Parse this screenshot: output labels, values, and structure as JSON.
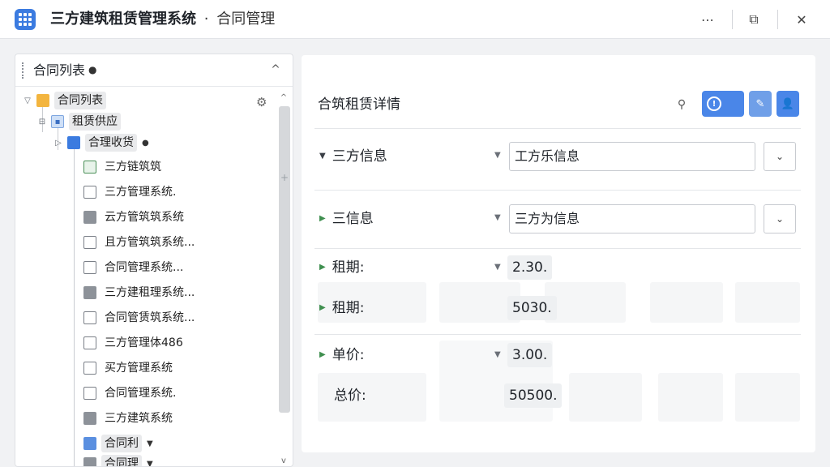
{
  "window": {
    "title_main": "三方建筑租赁管理系统",
    "title_sep": "·",
    "title_sub": "合同管理"
  },
  "titlebar_buttons": {
    "more": "⋯",
    "restore": "⧉",
    "close": "✕"
  },
  "left_panel": {
    "title": "合同列表",
    "title_mark": "●",
    "collapse": "^",
    "tree": [
      {
        "label": "合同列表",
        "level": 0,
        "icon": "folder-icon",
        "twisty": "▽"
      },
      {
        "label": "租赁供应",
        "level": 1,
        "icon": "person-icon",
        "twisty": "⊟"
      },
      {
        "label": "合理收货",
        "level": 2,
        "icon": "blue-folder-icon",
        "twisty": "▷",
        "mark": "●"
      },
      {
        "label": "三方链筑筑",
        "level": 3,
        "icon": "green-doc-icon"
      },
      {
        "label": "三方管理系统.",
        "level": 3,
        "icon": "shield-icon"
      },
      {
        "label": "云方管筑筑系统",
        "level": 3,
        "icon": "doc-icon"
      },
      {
        "label": "且方管筑筑系统...",
        "level": 3,
        "icon": "shield-icon"
      },
      {
        "label": "合同管理系统...",
        "level": 3,
        "icon": "shield-icon"
      },
      {
        "label": "三方建租理系统...",
        "level": 3,
        "icon": "doc-icon"
      },
      {
        "label": "合同管赁筑系统...",
        "level": 3,
        "icon": "shield-icon"
      },
      {
        "label": "三方管理体486",
        "level": 3,
        "icon": "shield-icon"
      },
      {
        "label": "买方管理系统",
        "level": 3,
        "icon": "shield-icon"
      },
      {
        "label": "合同管理系统.",
        "level": 3,
        "icon": "shield-icon"
      },
      {
        "label": "三方建筑系统",
        "level": 3,
        "icon": "doc-icon"
      },
      {
        "label": "合同利",
        "level": 3,
        "icon": "blue-doc-icon",
        "mark": "▼"
      },
      {
        "label": "合同理",
        "level": 3,
        "icon": "doc-icon",
        "mark": "▼"
      }
    ],
    "gear": "⚙",
    "scroll_up": "^",
    "scroll_down": "v",
    "splitter": "+"
  },
  "right_panel": {
    "title": "合筑租赁详情",
    "pin": "⚲",
    "toggle_knob": "!",
    "edit": "✎",
    "user": "👤",
    "fields": {
      "party_label": "三方信息",
      "party_value": "工方乐信息",
      "info_label": "三信息",
      "info_value": "三方为信息",
      "term1_label": "租期:",
      "term1_value": "2.30.",
      "term2_label": "租期:",
      "term2_value": "5030.",
      "price_label": "单价:",
      "price_value": "3.00.",
      "total_label": "总价:",
      "total_value": "50500."
    },
    "select_chevron": "⌄"
  }
}
